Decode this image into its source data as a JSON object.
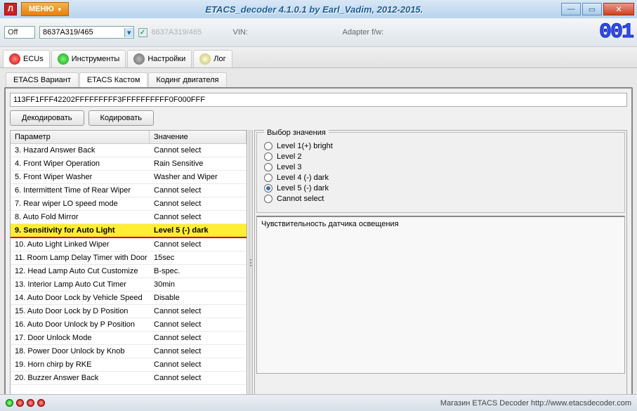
{
  "title": "ETACS_decoder 4.1.0.1 by Earl_Vadim, 2012-2015.",
  "menu_label": "МЕНЮ",
  "toolbar": {
    "off": "Off",
    "combo_value": "8637A319/465",
    "grey_label": "8637A319/465",
    "vin_label": "VIN:",
    "adapter_label": "Adapter f/w:",
    "counter": "001"
  },
  "tabs": [
    {
      "label": "ECUs"
    },
    {
      "label": "Инструменты"
    },
    {
      "label": "Настройки"
    },
    {
      "label": "Лог"
    }
  ],
  "subtabs": [
    {
      "label": "ETACS Вариант"
    },
    {
      "label": "ETACS Кастом"
    },
    {
      "label": "Кодинг двигателя"
    }
  ],
  "hex": "113FF1FFF42202FFFFFFFFF3FFFFFFFFFF0F000FFF",
  "btn_decode": "Декодировать",
  "btn_encode": "Кодировать",
  "grid": {
    "h1": "Параметр",
    "h2": "Значение",
    "rows": [
      {
        "p": "3. Hazard Answer Back",
        "v": "Cannot select"
      },
      {
        "p": "4. Front Wiper Operation",
        "v": "Rain Sensitive"
      },
      {
        "p": "5. Front Wiper Washer",
        "v": "Washer and Wiper"
      },
      {
        "p": "6. Intermittent Time of Rear Wiper",
        "v": "Cannot select"
      },
      {
        "p": "7. Rear wiper LO speed mode",
        "v": "Cannot select"
      },
      {
        "p": "8. Auto Fold Mirror",
        "v": "Cannot select"
      },
      {
        "p": "9. Sensitivity for Auto Light",
        "v": "Level 5 (-) dark",
        "sel": true
      },
      {
        "p": "10. Auto Light Linked Wiper",
        "v": "Cannot select"
      },
      {
        "p": "11. Room Lamp Delay Timer with Door",
        "v": "15sec"
      },
      {
        "p": "12. Head Lamp Auto Cut Customize",
        "v": "B-spec."
      },
      {
        "p": "13. Interior Lamp Auto Cut Timer",
        "v": "30min"
      },
      {
        "p": "14. Auto Door Lock by Vehicle Speed",
        "v": "Disable"
      },
      {
        "p": "15. Auto Door Lock by D Position",
        "v": "Cannot select"
      },
      {
        "p": "16. Auto Door Unlock by P Position",
        "v": "Cannot select"
      },
      {
        "p": "17. Door Unlock Mode",
        "v": "Cannot select"
      },
      {
        "p": "18. Power Door Unlock by Knob",
        "v": "Cannot select"
      },
      {
        "p": "19. Horn chirp by RKE",
        "v": "Cannot select"
      },
      {
        "p": "20. Buzzer Answer Back",
        "v": "Cannot select"
      }
    ]
  },
  "sel_panel": {
    "legend": "Выбор значения",
    "options": [
      {
        "label": "Level 1(+) bright"
      },
      {
        "label": "Level 2"
      },
      {
        "label": "Level 3"
      },
      {
        "label": "Level 4 (-) dark"
      },
      {
        "label": "Level 5 (-) dark",
        "on": true
      },
      {
        "label": "Cannot select"
      }
    ],
    "desc": "Чувствительность датчика освещения"
  },
  "status": {
    "text": "Магазин ETACS Decoder http://www.etacsdecoder.com"
  }
}
